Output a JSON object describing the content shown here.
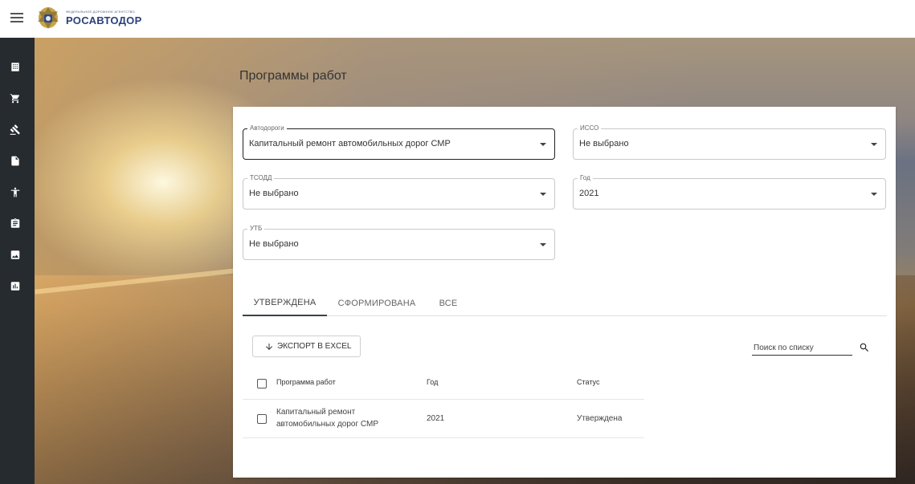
{
  "header": {
    "logo_small": "ФЕДЕРАЛЬНОЕ ДОРОЖНОЕ АГЕНТСТВО",
    "logo_name": "РОСАВТОДОР"
  },
  "sidebar": {
    "items": [
      {
        "icon": "building-icon"
      },
      {
        "icon": "cart-icon"
      },
      {
        "icon": "gavel-icon"
      },
      {
        "icon": "document-icon"
      },
      {
        "icon": "accessibility-icon"
      },
      {
        "icon": "clipboard-icon"
      },
      {
        "icon": "image-icon"
      },
      {
        "icon": "chart-icon"
      }
    ]
  },
  "page": {
    "title": "Программы работ"
  },
  "filters": {
    "roads": {
      "label": "Автодороги",
      "value": "Капитальный ремонт автомобильных дорог СМР"
    },
    "isso": {
      "label": "ИССО",
      "value": "Не выбрано"
    },
    "tsodd": {
      "label": "ТСОДД",
      "value": "Не выбрано"
    },
    "year": {
      "label": "Год",
      "value": "2021"
    },
    "utb": {
      "label": "УТБ",
      "value": "Не выбрано"
    }
  },
  "tabs": [
    {
      "label": "УТВЕРЖДЕНА",
      "active": true
    },
    {
      "label": "СФОРМИРОВАНА",
      "active": false
    },
    {
      "label": "ВСЕ",
      "active": false
    }
  ],
  "toolbar": {
    "export_label": "ЭКСПОРТ В EXCEL",
    "search_placeholder": "Поиск по списку"
  },
  "table": {
    "columns": [
      "Программа работ",
      "Год",
      "Статус"
    ],
    "rows": [
      {
        "program_line1": "Капитальный ремонт",
        "program_line2": "автомобильных дорог СМР",
        "year": "2021",
        "status": "Утверждена"
      }
    ]
  }
}
